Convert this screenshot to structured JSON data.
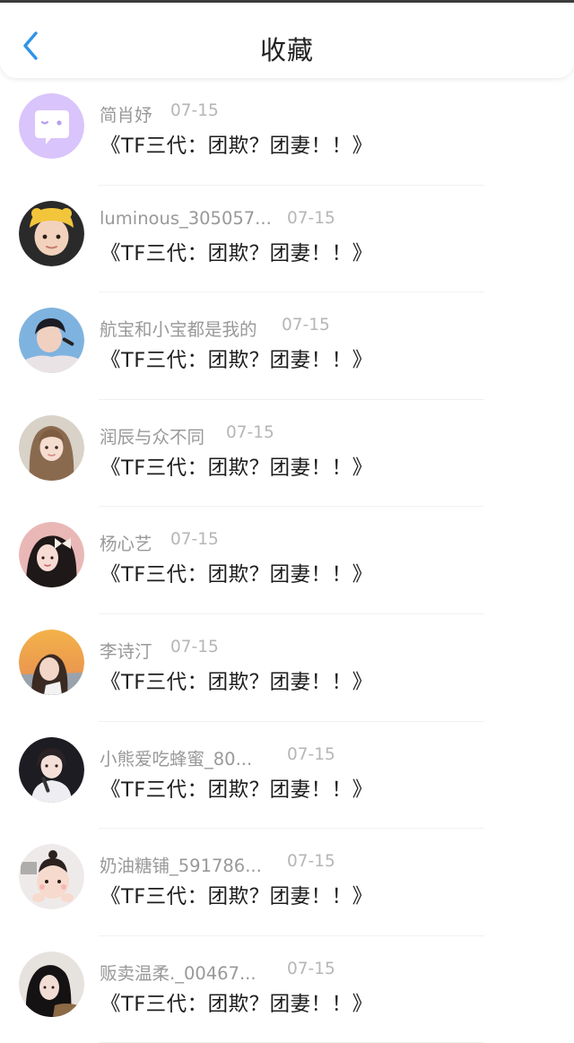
{
  "header": {
    "title": "收藏",
    "back_icon": "chevron-left-icon",
    "accent_color": "#2f93e8"
  },
  "items": [
    {
      "name": "简肖妤",
      "date": "07-15",
      "content": "《TF三代：团欺？团妻！！》",
      "avatar": "chat-bubble-avatar"
    },
    {
      "name": "luminous_305057...",
      "date": "07-15",
      "content": "《TF三代：团欺？团妻！！》",
      "avatar": "child-yellow-hat-avatar"
    },
    {
      "name": "航宝和小宝都是我的",
      "date": "07-15",
      "content": "《TF三代：团欺？团妻！！》",
      "avatar": "singer-with-mic-avatar"
    },
    {
      "name": "润辰与众不同",
      "date": "07-15",
      "content": "《TF三代：团欺？团妻！！》",
      "avatar": "girl-long-hair-avatar"
    },
    {
      "name": "杨心艺",
      "date": "07-15",
      "content": "《TF三代：团欺？团妻！！》",
      "avatar": "girl-hair-bow-avatar"
    },
    {
      "name": "李诗汀",
      "date": "07-15",
      "content": "《TF三代：团欺？团妻！！》",
      "avatar": "girl-sunset-avatar"
    },
    {
      "name": "小熊爱吃蜂蜜_80...",
      "date": "07-15",
      "content": "《TF三代：团欺？团妻！！》",
      "avatar": "girl-with-mic-avatar"
    },
    {
      "name": "奶油糖铺_591786...",
      "date": "07-15",
      "content": "《TF三代：团欺？团妻！！》",
      "avatar": "baby-avatar"
    },
    {
      "name": "贩卖温柔._00467...",
      "date": "07-15",
      "content": "《TF三代：团欺？团妻！！》",
      "avatar": "girl-dark-avatar"
    }
  ]
}
